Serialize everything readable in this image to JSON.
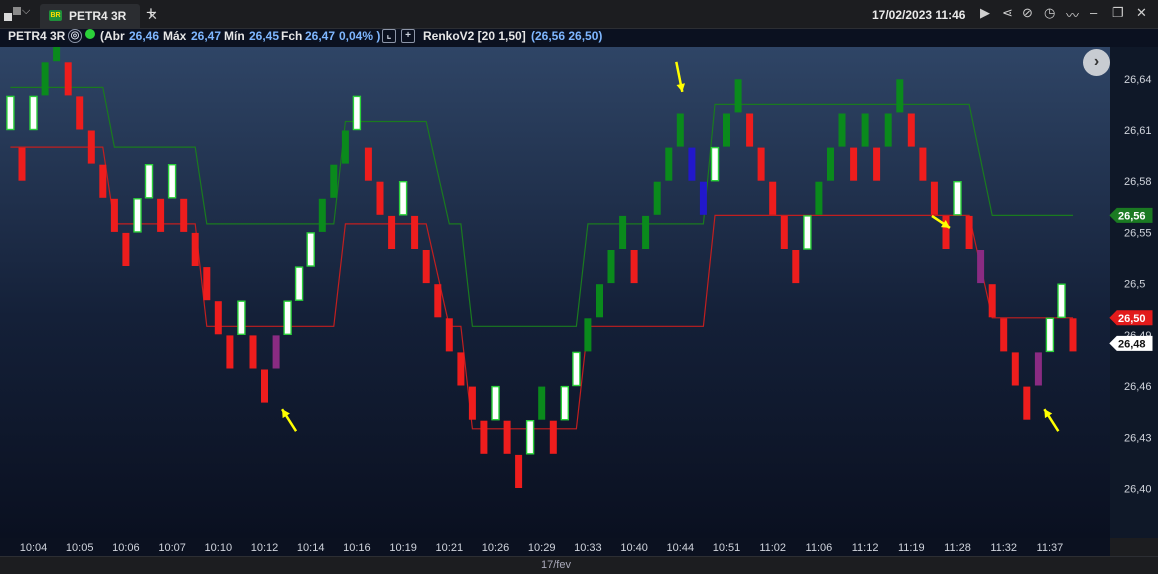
{
  "window": {
    "tab_label": "PETR4 3R",
    "tab_badge": "BR",
    "datetime": "17/02/2023 11:46",
    "icons": [
      "play-icon",
      "share-icon",
      "link-icon",
      "clock-icon",
      "wave-icon",
      "minimize-icon",
      "restore-icon",
      "close-icon"
    ]
  },
  "info": {
    "symbol": "PETR4 3R",
    "abr_label": "(Abr",
    "abr": "26,46",
    "max_label": "Máx",
    "max": "26,47",
    "min_label": "Mín",
    "min": "26,45",
    "fch_label": "Fch",
    "fch": "26,47",
    "chg": "0,04% )",
    "indicator_name": "RenkoV2 [20 1,50]",
    "indicator_values": "(26,56  26,50)"
  },
  "date_label": "17/fev",
  "colors": {
    "up": "#0a8a1c",
    "down": "#ee1d1d",
    "hollow_border": "#2bd13a",
    "magenta": "#8a2b82",
    "blue": "#2218cc",
    "upper_line": "#1a7a1f",
    "lower_line": "#c21f1f",
    "arrow": "#ffff00"
  },
  "chart_data": {
    "type": "renko",
    "box_size": 0.01,
    "y_ticks": [
      "26,64",
      "26,61",
      "26,58",
      "26,55",
      "26,5",
      "26,49",
      "26,46",
      "26,43",
      "26,40"
    ],
    "y_tick_values": [
      26.64,
      26.61,
      26.58,
      26.55,
      26.52,
      26.49,
      26.46,
      26.43,
      26.4
    ],
    "price_tags": [
      {
        "label": "26,56",
        "value": 26.56,
        "style": "green"
      },
      {
        "label": "26,50",
        "value": 26.5,
        "style": "red"
      },
      {
        "label": "26,48",
        "value": 26.485,
        "style": "white"
      }
    ],
    "x_labels": [
      "10:04",
      "10:05",
      "10:06",
      "10:07",
      "10:10",
      "10:12",
      "10:14",
      "10:16",
      "10:19",
      "10:21",
      "10:26",
      "10:29",
      "10:33",
      "10:40",
      "10:44",
      "10:51",
      "11:02",
      "11:06",
      "11:12",
      "11:19",
      "11:28",
      "11:32",
      "11:37"
    ],
    "x_label_idx": [
      2,
      6,
      10,
      14,
      18,
      22,
      26,
      30,
      34,
      38,
      42,
      46,
      50,
      54,
      58,
      62,
      66,
      70,
      74,
      78,
      82,
      86,
      90
    ],
    "bricks": [
      {
        "i": 0,
        "lo": 26.61,
        "hi": 26.63,
        "k": "h"
      },
      {
        "i": 1,
        "lo": 26.58,
        "hi": 26.6,
        "k": "r"
      },
      {
        "i": 2,
        "lo": 26.61,
        "hi": 26.63,
        "k": "h"
      },
      {
        "i": 3,
        "lo": 26.63,
        "hi": 26.65,
        "k": "g"
      },
      {
        "i": 4,
        "lo": 26.65,
        "hi": 26.67,
        "k": "g"
      },
      {
        "i": 5,
        "lo": 26.63,
        "hi": 26.65,
        "k": "r"
      },
      {
        "i": 6,
        "lo": 26.61,
        "hi": 26.63,
        "k": "r"
      },
      {
        "i": 7,
        "lo": 26.59,
        "hi": 26.61,
        "k": "r"
      },
      {
        "i": 8,
        "lo": 26.57,
        "hi": 26.59,
        "k": "r"
      },
      {
        "i": 9,
        "lo": 26.55,
        "hi": 26.57,
        "k": "r"
      },
      {
        "i": 10,
        "lo": 26.53,
        "hi": 26.55,
        "k": "r"
      },
      {
        "i": 11,
        "lo": 26.55,
        "hi": 26.57,
        "k": "h"
      },
      {
        "i": 12,
        "lo": 26.57,
        "hi": 26.59,
        "k": "h"
      },
      {
        "i": 13,
        "lo": 26.55,
        "hi": 26.57,
        "k": "r"
      },
      {
        "i": 14,
        "lo": 26.57,
        "hi": 26.59,
        "k": "h"
      },
      {
        "i": 15,
        "lo": 26.55,
        "hi": 26.57,
        "k": "r"
      },
      {
        "i": 16,
        "lo": 26.53,
        "hi": 26.55,
        "k": "r"
      },
      {
        "i": 17,
        "lo": 26.51,
        "hi": 26.53,
        "k": "r"
      },
      {
        "i": 18,
        "lo": 26.49,
        "hi": 26.51,
        "k": "r"
      },
      {
        "i": 19,
        "lo": 26.47,
        "hi": 26.49,
        "k": "r"
      },
      {
        "i": 20,
        "lo": 26.49,
        "hi": 26.51,
        "k": "h"
      },
      {
        "i": 21,
        "lo": 26.47,
        "hi": 26.49,
        "k": "r"
      },
      {
        "i": 22,
        "lo": 26.45,
        "hi": 26.47,
        "k": "r"
      },
      {
        "i": 23,
        "lo": 26.47,
        "hi": 26.49,
        "k": "m"
      },
      {
        "i": 24,
        "lo": 26.49,
        "hi": 26.51,
        "k": "h"
      },
      {
        "i": 25,
        "lo": 26.51,
        "hi": 26.53,
        "k": "h"
      },
      {
        "i": 26,
        "lo": 26.53,
        "hi": 26.55,
        "k": "h"
      },
      {
        "i": 27,
        "lo": 26.55,
        "hi": 26.57,
        "k": "g"
      },
      {
        "i": 28,
        "lo": 26.57,
        "hi": 26.59,
        "k": "g"
      },
      {
        "i": 29,
        "lo": 26.59,
        "hi": 26.61,
        "k": "g"
      },
      {
        "i": 30,
        "lo": 26.61,
        "hi": 26.63,
        "k": "h"
      },
      {
        "i": 31,
        "lo": 26.58,
        "hi": 26.6,
        "k": "r"
      },
      {
        "i": 32,
        "lo": 26.56,
        "hi": 26.58,
        "k": "r"
      },
      {
        "i": 33,
        "lo": 26.54,
        "hi": 26.56,
        "k": "r"
      },
      {
        "i": 34,
        "lo": 26.56,
        "hi": 26.58,
        "k": "h"
      },
      {
        "i": 35,
        "lo": 26.54,
        "hi": 26.56,
        "k": "r"
      },
      {
        "i": 36,
        "lo": 26.52,
        "hi": 26.54,
        "k": "r"
      },
      {
        "i": 37,
        "lo": 26.5,
        "hi": 26.52,
        "k": "r"
      },
      {
        "i": 38,
        "lo": 26.48,
        "hi": 26.5,
        "k": "r"
      },
      {
        "i": 39,
        "lo": 26.46,
        "hi": 26.48,
        "k": "r"
      },
      {
        "i": 40,
        "lo": 26.44,
        "hi": 26.46,
        "k": "r"
      },
      {
        "i": 41,
        "lo": 26.42,
        "hi": 26.44,
        "k": "r"
      },
      {
        "i": 42,
        "lo": 26.44,
        "hi": 26.46,
        "k": "h"
      },
      {
        "i": 43,
        "lo": 26.42,
        "hi": 26.44,
        "k": "r"
      },
      {
        "i": 44,
        "lo": 26.4,
        "hi": 26.42,
        "k": "r"
      },
      {
        "i": 45,
        "lo": 26.42,
        "hi": 26.44,
        "k": "h"
      },
      {
        "i": 46,
        "lo": 26.44,
        "hi": 26.46,
        "k": "g"
      },
      {
        "i": 47,
        "lo": 26.42,
        "hi": 26.44,
        "k": "r"
      },
      {
        "i": 48,
        "lo": 26.44,
        "hi": 26.46,
        "k": "h"
      },
      {
        "i": 49,
        "lo": 26.46,
        "hi": 26.48,
        "k": "h"
      },
      {
        "i": 50,
        "lo": 26.48,
        "hi": 26.5,
        "k": "g"
      },
      {
        "i": 51,
        "lo": 26.5,
        "hi": 26.52,
        "k": "g"
      },
      {
        "i": 52,
        "lo": 26.52,
        "hi": 26.54,
        "k": "g"
      },
      {
        "i": 53,
        "lo": 26.54,
        "hi": 26.56,
        "k": "g"
      },
      {
        "i": 54,
        "lo": 26.52,
        "hi": 26.54,
        "k": "r"
      },
      {
        "i": 55,
        "lo": 26.54,
        "hi": 26.56,
        "k": "g"
      },
      {
        "i": 56,
        "lo": 26.56,
        "hi": 26.58,
        "k": "g"
      },
      {
        "i": 57,
        "lo": 26.58,
        "hi": 26.6,
        "k": "g"
      },
      {
        "i": 58,
        "lo": 26.6,
        "hi": 26.62,
        "k": "g"
      },
      {
        "i": 59,
        "lo": 26.58,
        "hi": 26.6,
        "k": "b"
      },
      {
        "i": 60,
        "lo": 26.56,
        "hi": 26.58,
        "k": "b"
      },
      {
        "i": 61,
        "lo": 26.58,
        "hi": 26.6,
        "k": "h"
      },
      {
        "i": 62,
        "lo": 26.6,
        "hi": 26.62,
        "k": "g"
      },
      {
        "i": 63,
        "lo": 26.62,
        "hi": 26.64,
        "k": "g"
      },
      {
        "i": 64,
        "lo": 26.6,
        "hi": 26.62,
        "k": "r"
      },
      {
        "i": 65,
        "lo": 26.58,
        "hi": 26.6,
        "k": "r"
      },
      {
        "i": 66,
        "lo": 26.56,
        "hi": 26.58,
        "k": "r"
      },
      {
        "i": 67,
        "lo": 26.54,
        "hi": 26.56,
        "k": "r"
      },
      {
        "i": 68,
        "lo": 26.52,
        "hi": 26.54,
        "k": "r"
      },
      {
        "i": 69,
        "lo": 26.54,
        "hi": 26.56,
        "k": "h"
      },
      {
        "i": 70,
        "lo": 26.56,
        "hi": 26.58,
        "k": "g"
      },
      {
        "i": 71,
        "lo": 26.58,
        "hi": 26.6,
        "k": "g"
      },
      {
        "i": 72,
        "lo": 26.6,
        "hi": 26.62,
        "k": "g"
      },
      {
        "i": 73,
        "lo": 26.58,
        "hi": 26.6,
        "k": "r"
      },
      {
        "i": 74,
        "lo": 26.6,
        "hi": 26.62,
        "k": "g"
      },
      {
        "i": 75,
        "lo": 26.58,
        "hi": 26.6,
        "k": "r"
      },
      {
        "i": 76,
        "lo": 26.6,
        "hi": 26.62,
        "k": "g"
      },
      {
        "i": 77,
        "lo": 26.62,
        "hi": 26.64,
        "k": "g"
      },
      {
        "i": 78,
        "lo": 26.6,
        "hi": 26.62,
        "k": "r"
      },
      {
        "i": 79,
        "lo": 26.58,
        "hi": 26.6,
        "k": "r"
      },
      {
        "i": 80,
        "lo": 26.56,
        "hi": 26.58,
        "k": "r"
      },
      {
        "i": 81,
        "lo": 26.54,
        "hi": 26.56,
        "k": "r"
      },
      {
        "i": 82,
        "lo": 26.56,
        "hi": 26.58,
        "k": "h"
      },
      {
        "i": 83,
        "lo": 26.54,
        "hi": 26.56,
        "k": "r"
      },
      {
        "i": 84,
        "lo": 26.52,
        "hi": 26.54,
        "k": "m"
      },
      {
        "i": 85,
        "lo": 26.5,
        "hi": 26.52,
        "k": "r"
      },
      {
        "i": 86,
        "lo": 26.48,
        "hi": 26.5,
        "k": "r"
      },
      {
        "i": 87,
        "lo": 26.46,
        "hi": 26.48,
        "k": "r"
      },
      {
        "i": 88,
        "lo": 26.44,
        "hi": 26.46,
        "k": "r"
      },
      {
        "i": 89,
        "lo": 26.46,
        "hi": 26.48,
        "k": "m"
      },
      {
        "i": 90,
        "lo": 26.48,
        "hi": 26.5,
        "k": "h"
      },
      {
        "i": 91,
        "lo": 26.5,
        "hi": 26.52,
        "k": "h"
      },
      {
        "i": 92,
        "lo": 26.48,
        "hi": 26.5,
        "k": "r"
      }
    ],
    "upper_line": [
      [
        0,
        26.635
      ],
      [
        8,
        26.635
      ],
      [
        9,
        26.6
      ],
      [
        16,
        26.6
      ],
      [
        17,
        26.555
      ],
      [
        28,
        26.555
      ],
      [
        29,
        26.615
      ],
      [
        36,
        26.615
      ],
      [
        38,
        26.555
      ],
      [
        39,
        26.555
      ],
      [
        40,
        26.495
      ],
      [
        49,
        26.495
      ],
      [
        50,
        26.555
      ],
      [
        60,
        26.555
      ],
      [
        61,
        26.625
      ],
      [
        83,
        26.625
      ],
      [
        85,
        26.56
      ],
      [
        92,
        26.56
      ]
    ],
    "lower_line": [
      [
        0,
        26.6
      ],
      [
        8,
        26.6
      ],
      [
        9,
        26.555
      ],
      [
        16,
        26.555
      ],
      [
        17,
        26.495
      ],
      [
        28,
        26.495
      ],
      [
        29,
        26.555
      ],
      [
        36,
        26.555
      ],
      [
        38,
        26.495
      ],
      [
        39,
        26.495
      ],
      [
        40,
        26.435
      ],
      [
        49,
        26.435
      ],
      [
        50,
        26.495
      ],
      [
        60,
        26.495
      ],
      [
        61,
        26.56
      ],
      [
        83,
        26.56
      ],
      [
        85,
        26.5
      ],
      [
        92,
        26.5
      ]
    ],
    "arrows": [
      {
        "i": 23,
        "v": 26.45,
        "dir": "up-left"
      },
      {
        "i": 58,
        "v": 26.63,
        "dir": "down"
      },
      {
        "i": 81,
        "v": 26.555,
        "dir": "down-right"
      },
      {
        "i": 89,
        "v": 26.45,
        "dir": "up-left"
      }
    ]
  }
}
